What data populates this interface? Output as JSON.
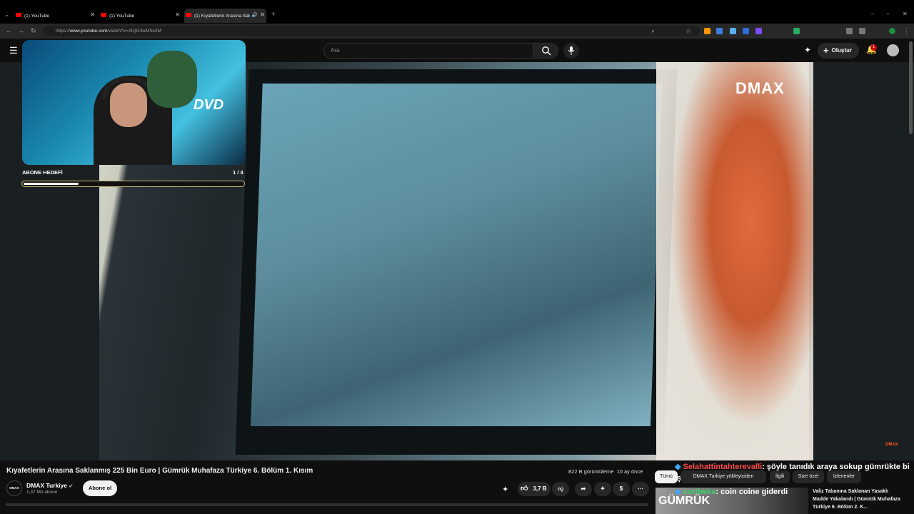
{
  "browser": {
    "tabs": [
      {
        "title": "(1) YouTube"
      },
      {
        "title": "(1) YouTube"
      },
      {
        "title": "(1) Kıyafetlerin Arasına Sakl..."
      }
    ],
    "url_prefix": "https://",
    "url_domain": "www.youtube.com",
    "url_path": "/watch?v=AlQG3wMSk3M"
  },
  "youtube": {
    "search_placeholder": "Ara",
    "create_label": "Oluştur",
    "notification_count": "1"
  },
  "video": {
    "watermark": "DMAX",
    "watermark_small": "DMAX",
    "overlay_text": "DVD",
    "subscriber_goal_label": "ABONE HEDEFİ",
    "subscriber_goal_count": "1 / 4",
    "subscriber_goal_fraction": 0.25,
    "title": "Kıyafetlerin Arasına Saklanmış 225 Bin Euro | Gümrük Muhafaza Türkiye 6. Bölüm 1. Kısım",
    "views": "822 B görüntüleme",
    "age": "10 ay önce"
  },
  "channel": {
    "avatar_text": "DMAX",
    "name": "DMAX Turkiye",
    "subscribers": "1,37 Mn abone",
    "subscribe_label": "Abone ol"
  },
  "actions": {
    "likes": "3,7 B"
  },
  "chat": [
    {
      "user": "Selahattintahterevalli",
      "message": ": şöyle tanıdık araya sokup gümrükte bi iş bulamadın mı"
    },
    {
      "user": "cortbeka",
      "message": ": coin coine giderdi"
    }
  ],
  "chips": [
    "Tümü",
    "DMAX Turkiye yükleyiciden",
    "İlgili",
    "Size özel",
    "İzlenenler"
  ],
  "recommendation": {
    "thumb_text": "GÜMRÜK",
    "title": "Valiz Tabanına Saklanan Yasaklı Madde Yakalandı | Gümrük Muhafaza Türkiye 6. Bölüm 2. K..."
  },
  "colors": {
    "accent": "#ff0000",
    "chat_user_red": "#ff4a4a",
    "chat_user_green": "#3ad06a",
    "dmax_orange": "#ff5a1f"
  }
}
